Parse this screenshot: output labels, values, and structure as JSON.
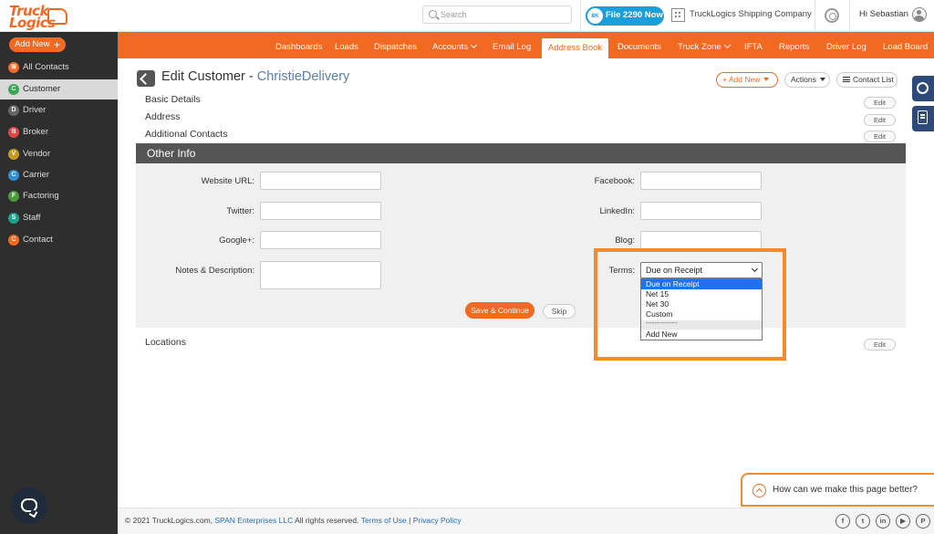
{
  "brand": {
    "logo_line1": "Truck",
    "logo_line2": "Logics"
  },
  "header": {
    "search_placeholder": "Search",
    "file_badge": "8K",
    "file_button": "File 2290 Now",
    "company": "TruckLogics Shipping Company",
    "greeting": "Hi Sebastian"
  },
  "sidebar": {
    "add_new": "Add New",
    "items": [
      {
        "label": "All Contacts",
        "letter": "⊞",
        "color": "#f26a21"
      },
      {
        "label": "Customer",
        "letter": "C",
        "color": "#3aa655"
      },
      {
        "label": "Driver",
        "letter": "D",
        "color": "#666666"
      },
      {
        "label": "Broker",
        "letter": "B",
        "color": "#e04848"
      },
      {
        "label": "Vendor",
        "letter": "V",
        "color": "#c99a1c"
      },
      {
        "label": "Carrier",
        "letter": "C",
        "color": "#2f8fd8"
      },
      {
        "label": "Factoring",
        "letter": "F",
        "color": "#4c9a3c"
      },
      {
        "label": "Staff",
        "letter": "S",
        "color": "#1fa08a"
      },
      {
        "label": "Contact",
        "letter": "C",
        "color": "#f26a21"
      }
    ]
  },
  "nav": {
    "items": [
      "Dashboards",
      "Loads",
      "Dispatches",
      "Accounts",
      "Email Log",
      "Address Book",
      "Documents",
      "Truck Zone",
      "IFTA",
      "Reports",
      "Driver Log",
      "Load Board"
    ],
    "active": "Address Book"
  },
  "page": {
    "title_prefix": "Edit Customer - ",
    "customer_name": "ChristieDelivery",
    "add_new_btn": "Add New",
    "actions_btn": "Actions",
    "contact_list_btn": "Contact List"
  },
  "sections": {
    "basic": "Basic Details",
    "address": "Address",
    "additional": "Additional Contacts",
    "other": "Other Info",
    "locations": "Locations",
    "edit": "Edit"
  },
  "form": {
    "website": "Website URL:",
    "twitter": "Twitter:",
    "google": "Google+:",
    "notes": "Notes & Description:",
    "facebook": "Facebook:",
    "linkedin": "LinkedIn:",
    "blog": "Blog:",
    "terms": "Terms:",
    "terms_value": "Due on Receipt",
    "terms_options": [
      "Due on Receipt",
      "Net 15",
      "Net 30",
      "Custom",
      "---------------",
      "Add New"
    ],
    "save": "Save & Continue",
    "skip": "Skip"
  },
  "feedback": "How can we make this page better?",
  "footer": {
    "copy": "© 2021 TruckLogics.com, ",
    "company_link": "SPAN Enterprises LLC",
    "rights": " All rights reserved. ",
    "terms": "Terms of Use",
    "sep": " | ",
    "privacy": "Privacy Policy",
    "social": [
      "f",
      "t",
      "in",
      "▶",
      "P"
    ]
  }
}
